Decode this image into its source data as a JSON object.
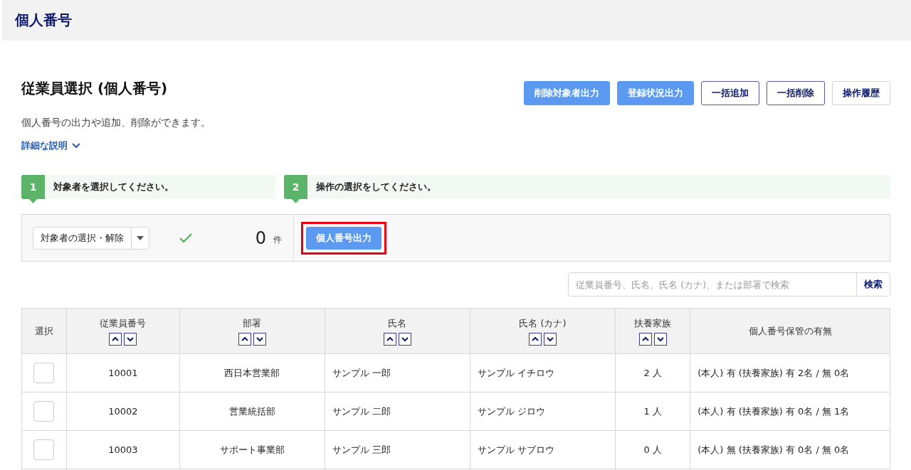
{
  "header": {
    "title": "個人番号"
  },
  "page": {
    "title": "従業員選択 (個人番号)",
    "description": "個人番号の出力や追加、削除ができます。",
    "details_link": "詳細な説明"
  },
  "top_buttons": [
    {
      "label": "削除対象者出力",
      "kind": "primary"
    },
    {
      "label": "登録状況出力",
      "kind": "primary"
    },
    {
      "label": "一括追加",
      "kind": "outline"
    },
    {
      "label": "一括削除",
      "kind": "outline"
    },
    {
      "label": "操作履歴",
      "kind": "plain"
    }
  ],
  "steps": [
    {
      "number": "1",
      "text": "対象者を選択してください。"
    },
    {
      "number": "2",
      "text": "操作の選択をしてください。"
    }
  ],
  "selection": {
    "dropdown": "対象者の選択・解除",
    "count": "0",
    "unit": "件"
  },
  "action_button": {
    "label": "個人番号出力",
    "highlighted": true
  },
  "search": {
    "placeholder": "従業員番号、氏名、氏名 (カナ)、または部署で検索",
    "button": "検索"
  },
  "table": {
    "columns": [
      {
        "label": "選択",
        "sortable": false
      },
      {
        "label": "従業員番号",
        "sortable": true
      },
      {
        "label": "部署",
        "sortable": true
      },
      {
        "label": "氏名",
        "sortable": true
      },
      {
        "label": "氏名 (カナ)",
        "sortable": true
      },
      {
        "label": "扶養家族",
        "sortable": true
      },
      {
        "label": "個人番号保管の有無",
        "sortable": false
      }
    ],
    "rows": [
      {
        "checked": false,
        "cells": [
          "",
          "10001",
          "西日本営業部",
          "サンプル 一郎",
          "サンプル イチロウ",
          "2 人",
          "(本人) 有 (扶養家族) 有 2名 / 無 0名"
        ]
      },
      {
        "checked": false,
        "cells": [
          "",
          "10002",
          "営業統括部",
          "サンプル 二郎",
          "サンプル ジロウ",
          "1 人",
          "(本人) 有 (扶養家族) 有 0名 / 無 1名"
        ]
      },
      {
        "checked": false,
        "cells": [
          "",
          "10003",
          "サポート事業部",
          "サンプル 三郎",
          "サンプル サブロウ",
          "0 人",
          "(本人) 無 (扶養家族) 有 0名 / 無 0名"
        ]
      }
    ]
  }
}
